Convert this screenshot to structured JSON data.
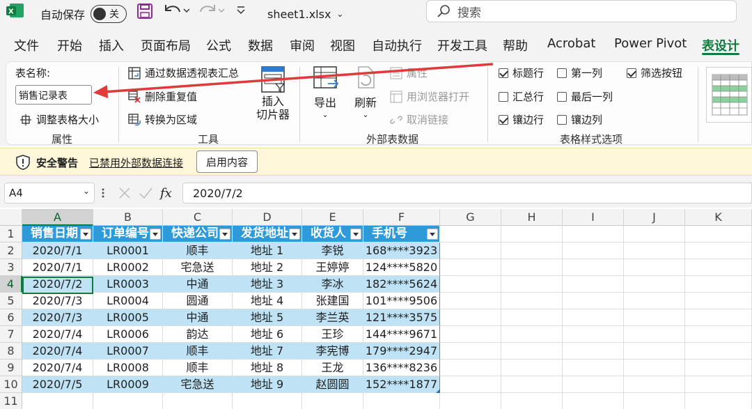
{
  "titlebar": {
    "autosave_label": "自动保存",
    "autosave_state": "关",
    "filename": "sheet1.xlsx",
    "search_placeholder": "搜索"
  },
  "tabs": [
    {
      "label": "文件"
    },
    {
      "label": "开始"
    },
    {
      "label": "插入"
    },
    {
      "label": "页面布局"
    },
    {
      "label": "公式"
    },
    {
      "label": "数据"
    },
    {
      "label": "审阅"
    },
    {
      "label": "视图"
    },
    {
      "label": "自动执行"
    },
    {
      "label": "开发工具"
    },
    {
      "label": "帮助"
    },
    {
      "label": "Acrobat"
    },
    {
      "label": "Power Pivot"
    },
    {
      "label": "表设计"
    }
  ],
  "ribbon": {
    "properties": {
      "table_name_label": "表名称:",
      "table_name_value": "销售记录表",
      "resize_label": "调整表格大小",
      "group_label": "属性"
    },
    "tools": {
      "pivot_label": "通过数据透视表汇总",
      "remove_dup_label": "删除重复值",
      "convert_label": "转换为区域",
      "slicer_label_1": "插入",
      "slicer_label_2": "切片器",
      "group_label": "工具"
    },
    "external": {
      "export_label": "导出",
      "refresh_label": "刷新",
      "properties_label": "属性",
      "browser_label": "用浏览器打开",
      "unlink_label": "取消链接",
      "group_label": "外部表数据"
    },
    "style_options": {
      "header_row": "标题行",
      "first_column": "第一列",
      "filter_button": "筛选按钮",
      "total_row": "汇总行",
      "last_column": "最后一列",
      "banded_rows": "镶边行",
      "banded_columns": "镶边列",
      "group_label": "表格样式选项",
      "checked": {
        "header_row": true,
        "first_column": false,
        "filter_button": true,
        "total_row": false,
        "last_column": false,
        "banded_rows": true,
        "banded_columns": false
      }
    }
  },
  "security": {
    "title": "安全警告",
    "message": "已禁用外部数据连接",
    "button": "启用内容"
  },
  "formula_bar": {
    "cell_ref": "A4",
    "formula": "2020/7/2"
  },
  "sheet": {
    "column_letters": [
      "A",
      "B",
      "C",
      "D",
      "E",
      "F",
      "G",
      "H",
      "I",
      "J",
      "K"
    ],
    "row_numbers": [
      "1",
      "2",
      "3",
      "4",
      "5",
      "6",
      "7",
      "8",
      "9",
      "10",
      "11"
    ],
    "headers": [
      "销售日期",
      "订单编号",
      "快递公司",
      "发货地址",
      "收货人",
      "手机号"
    ],
    "rows": [
      [
        "2020/7/1",
        "LR0001",
        "顺丰",
        "地址 1",
        "李锐",
        "168****3923"
      ],
      [
        "2020/7/1",
        "LR0002",
        "宅急送",
        "地址 2",
        "王婷婷",
        "124****5820"
      ],
      [
        "2020/7/2",
        "LR0003",
        "中通",
        "地址 3",
        "李冰",
        "182****5624"
      ],
      [
        "2020/7/3",
        "LR0004",
        "圆通",
        "地址 4",
        "张建国",
        "101****9506"
      ],
      [
        "2020/7/3",
        "LR0005",
        "中通",
        "地址 5",
        "李兰英",
        "121****3575"
      ],
      [
        "2020/7/4",
        "LR0006",
        "韵达",
        "地址 6",
        "王珍",
        "144****9671"
      ],
      [
        "2020/7/4",
        "LR0007",
        "顺丰",
        "地址 7",
        "李宪博",
        "179****2947"
      ],
      [
        "2020/7/4",
        "LR0008",
        "顺丰",
        "地址 8",
        "王龙",
        "136****8236"
      ],
      [
        "2020/7/5",
        "LR0009",
        "宅急送",
        "地址 9",
        "赵圆圆",
        "152****1877"
      ]
    ]
  },
  "colors": {
    "accent": "#0f7b3f",
    "table_header": "#2e9ad9",
    "band": "#bfe3f5",
    "arrow": "#e03a3a"
  }
}
